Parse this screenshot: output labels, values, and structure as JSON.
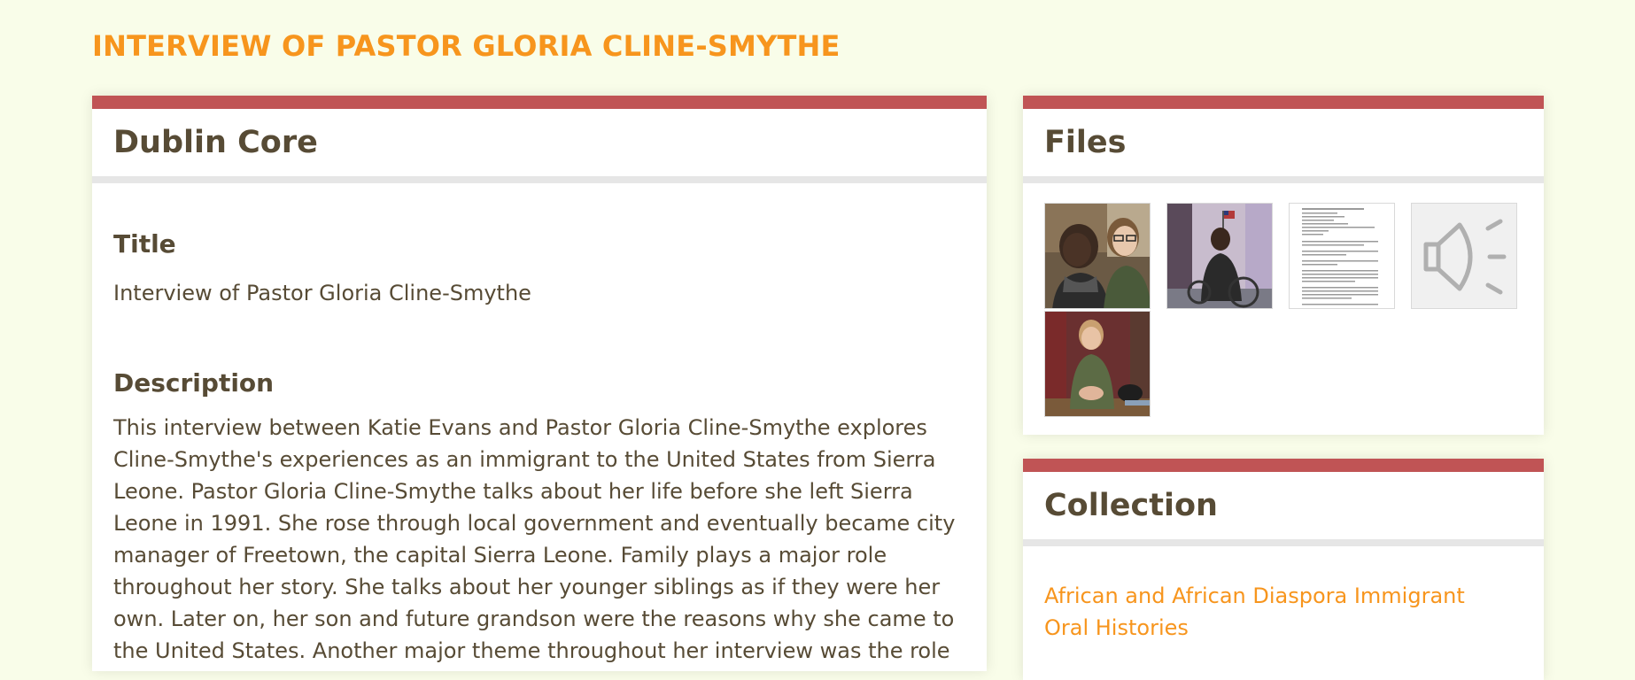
{
  "page": {
    "title": "INTERVIEW OF PASTOR GLORIA CLINE-SMYTHE"
  },
  "dublin_core": {
    "heading": "Dublin Core",
    "fields": {
      "title": {
        "label": "Title",
        "value": "Interview of Pastor Gloria Cline-Smythe"
      },
      "description": {
        "label": "Description",
        "value": "This interview between Katie Evans and Pastor Gloria Cline-Smythe explores Cline-Smythe's experiences as an immigrant to the United States from Sierra Leone. Pastor Gloria Cline-Smythe talks about her life before she left Sierra Leone in 1991. She rose through local government and eventually became city manager of Freetown, the capital Sierra Leone. Family plays a major role throughout her story. She talks about her younger siblings as if they were her own. Later on, her son and future grandson were the reasons why she came to the United States. Another major theme throughout her interview was the role of religion in her life. Religion was a key part of her life growing up, and this is"
      }
    }
  },
  "files": {
    "heading": "Files",
    "items": [
      {
        "kind": "photo",
        "icon": "photo-two-women-icon"
      },
      {
        "kind": "photo",
        "icon": "photo-woman-seated-icon"
      },
      {
        "kind": "document",
        "icon": "transcript-document-icon"
      },
      {
        "kind": "audio",
        "icon": "speaker-audio-icon"
      },
      {
        "kind": "photo",
        "icon": "photo-interviewer-icon"
      }
    ]
  },
  "collection": {
    "heading": "Collection",
    "link_text": "African and African Diaspora Immigrant Oral Histories"
  },
  "colors": {
    "background": "#f9fde9",
    "accent_orange": "#f7951d",
    "panel_top_border": "#c05455",
    "text": "#574b35"
  }
}
